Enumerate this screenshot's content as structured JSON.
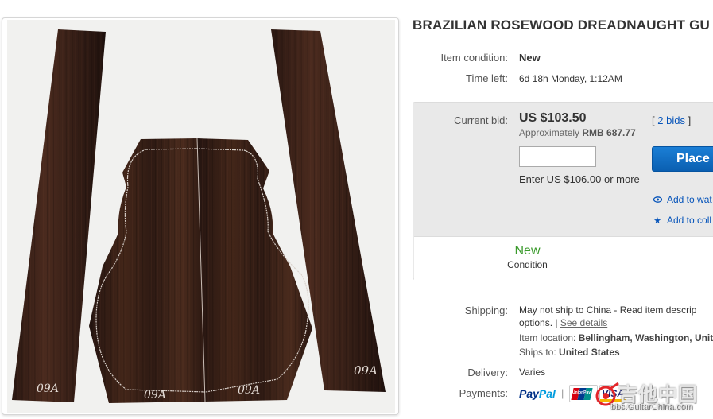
{
  "listing": {
    "title": "BRAZILIAN ROSEWOOD DREADNAUGHT GU",
    "photo_marks": {
      "left_strip": "09A",
      "back_left": "09A",
      "back_right": "09A",
      "right_strip": "09A"
    }
  },
  "details": {
    "condition_label": "Item condition:",
    "condition_value": "New",
    "time_label": "Time left:",
    "time_value": "6d 18h Monday, 1:12AM"
  },
  "bid": {
    "label": "Current bid:",
    "price": "US $103.50",
    "approx_prefix": "Approximately",
    "approx_value": "RMB 687.77",
    "bids_open": "[",
    "bids_link": "2 bids",
    "bids_close": "]",
    "input_value": "",
    "enter_hint": "Enter US $106.00 or more",
    "place_label": "Place",
    "watch_label": "Add to wat",
    "collection_label": "Add to coll",
    "badge_value": "New",
    "badge_label": "Condition"
  },
  "shipping": {
    "label": "Shipping:",
    "line1": "May not ship to China - Read item descrip",
    "line2_prefix": "options. |",
    "line2_link": "See details",
    "location_label": "Item location:",
    "location_value": "Bellingham, Washington, Unit",
    "ships_label": "Ships to:",
    "ships_value": "United States"
  },
  "delivery": {
    "label": "Delivery:",
    "value": "Varies"
  },
  "payments": {
    "label": "Payments:",
    "paypal_a": "Pay",
    "paypal_b": "Pal",
    "sep": "|",
    "unionpay": "UnionPay",
    "visa": "VISA"
  },
  "watermark": {
    "cn_text": "吉他中国",
    "url_text": "bbs.GuitarChina.com"
  },
  "colors": {
    "link": "#0654ba",
    "accent_blue": "#0a5fb1",
    "badge_green": "#3a9a2b",
    "wood": "#2c1a14"
  },
  "icons": {
    "watch": "eye-icon",
    "collection": "star-icon"
  }
}
